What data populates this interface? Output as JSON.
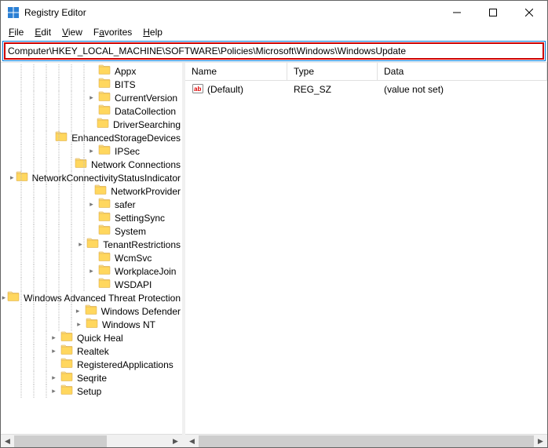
{
  "window": {
    "title": "Registry Editor"
  },
  "menu": {
    "file": "File",
    "edit": "Edit",
    "view": "View",
    "favorites": "Favorites",
    "help": "Help"
  },
  "address": "Computer\\HKEY_LOCAL_MACHINE\\SOFTWARE\\Policies\\Microsoft\\Windows\\WindowsUpdate",
  "columns": {
    "name": "Name",
    "type": "Type",
    "data": "Data"
  },
  "tree_items": [
    {
      "indent": 108,
      "expander": "none",
      "label": "Appx"
    },
    {
      "indent": 108,
      "expander": "none",
      "label": "BITS"
    },
    {
      "indent": 108,
      "expander": "closed",
      "label": "CurrentVersion"
    },
    {
      "indent": 108,
      "expander": "none",
      "label": "DataCollection"
    },
    {
      "indent": 108,
      "expander": "none",
      "label": "DriverSearching"
    },
    {
      "indent": 108,
      "expander": "none",
      "label": "EnhancedStorageDevices"
    },
    {
      "indent": 108,
      "expander": "closed",
      "label": "IPSec"
    },
    {
      "indent": 108,
      "expander": "none",
      "label": "Network Connections"
    },
    {
      "indent": 108,
      "expander": "closed",
      "label": "NetworkConnectivityStatusIndicator"
    },
    {
      "indent": 108,
      "expander": "none",
      "label": "NetworkProvider"
    },
    {
      "indent": 108,
      "expander": "closed",
      "label": "safer"
    },
    {
      "indent": 108,
      "expander": "none",
      "label": "SettingSync"
    },
    {
      "indent": 108,
      "expander": "none",
      "label": "System"
    },
    {
      "indent": 108,
      "expander": "closed",
      "label": "TenantRestrictions"
    },
    {
      "indent": 108,
      "expander": "none",
      "label": "WcmSvc"
    },
    {
      "indent": 108,
      "expander": "closed",
      "label": "WorkplaceJoin"
    },
    {
      "indent": 108,
      "expander": "none",
      "label": "WSDAPI"
    },
    {
      "indent": 92,
      "expander": "closed",
      "label": "Windows Advanced Threat Protection"
    },
    {
      "indent": 92,
      "expander": "closed",
      "label": "Windows Defender"
    },
    {
      "indent": 92,
      "expander": "closed",
      "label": "Windows NT"
    },
    {
      "indent": 60,
      "expander": "closed",
      "label": "Quick Heal"
    },
    {
      "indent": 60,
      "expander": "closed",
      "label": "Realtek"
    },
    {
      "indent": 60,
      "expander": "none",
      "label": "RegisteredApplications"
    },
    {
      "indent": 60,
      "expander": "closed",
      "label": "Seqrite"
    },
    {
      "indent": 60,
      "expander": "closed",
      "label": "Setup"
    }
  ],
  "values": [
    {
      "name": "(Default)",
      "type": "REG_SZ",
      "data": "(value not set)"
    }
  ]
}
